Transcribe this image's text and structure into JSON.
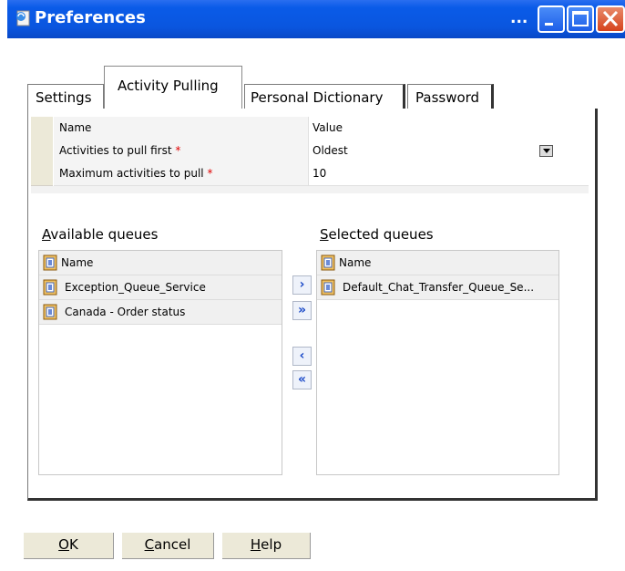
{
  "window": {
    "title": "Preferences",
    "title_dots": "..."
  },
  "tabs": [
    {
      "label": "Settings"
    },
    {
      "label": "Activity Pulling"
    },
    {
      "label": "Personal Dictionary"
    },
    {
      "label": "Password"
    }
  ],
  "grid": {
    "col_name": "Name",
    "col_value": "Value",
    "rows": [
      {
        "name": "Activities to pull first",
        "required": "*",
        "value": "Oldest"
      },
      {
        "name": "Maximum activities to pull",
        "required": "*",
        "value": "10"
      }
    ]
  },
  "available": {
    "label_first": "A",
    "label_rest": "vailable queues",
    "header": "Name",
    "items": [
      "Exception_Queue_Service",
      "Canada  - Order status"
    ]
  },
  "selected": {
    "label_first": "S",
    "label_rest": "elected queues",
    "header": "Name",
    "items": [
      "Default_Chat_Transfer_Queue_Se..."
    ]
  },
  "move_buttons": [
    {
      "glyph": "›"
    },
    {
      "glyph": "»"
    },
    {
      "glyph": "‹"
    },
    {
      "glyph": "«"
    }
  ],
  "buttons": {
    "ok_first": "O",
    "ok_rest": "K",
    "cancel_first": "C",
    "cancel_rest": "ancel",
    "help_first": "H",
    "help_rest": "elp"
  },
  "colors": {
    "titlebar": "#0a56df",
    "required": "#e00000",
    "arrow": "#1a49c8"
  },
  "icons": [
    "app-icon",
    "minimize-icon",
    "maximize-icon",
    "close-icon",
    "queue-icon",
    "move-right-icon",
    "move-all-right-icon",
    "move-left-icon",
    "move-all-left-icon",
    "combo-arrow-icon"
  ]
}
